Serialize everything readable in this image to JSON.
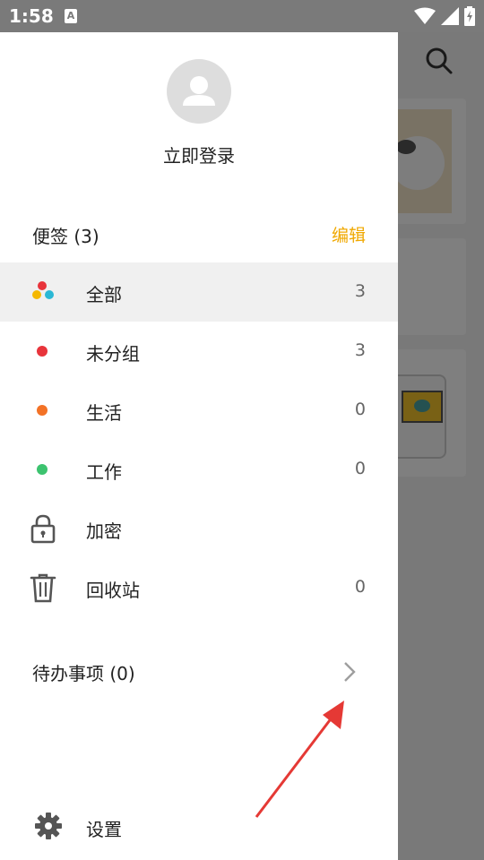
{
  "status_bar": {
    "time": "1:58",
    "notification_icon": "A",
    "icons": [
      "wifi-icon",
      "signal-icon",
      "battery-icon"
    ]
  },
  "drawer": {
    "login_text": "立即登录",
    "notes_section": {
      "title": "便签 (3)",
      "edit_label": "编辑"
    },
    "groups": [
      {
        "label": "全部",
        "count": "3",
        "icon": "multi-color-dots-icon",
        "active": true
      },
      {
        "label": "未分组",
        "count": "3",
        "icon": "dot-icon",
        "color": "#e8343b"
      },
      {
        "label": "生活",
        "count": "0",
        "icon": "dot-icon",
        "color": "#f37226"
      },
      {
        "label": "工作",
        "count": "0",
        "icon": "dot-icon",
        "color": "#3cc36f"
      },
      {
        "label": "加密",
        "count": "",
        "icon": "lock-icon"
      },
      {
        "label": "回收站",
        "count": "0",
        "icon": "trash-icon"
      }
    ],
    "todo": {
      "label": "待办事项 (0)"
    },
    "settings": {
      "label": "设置"
    }
  },
  "colors": {
    "accent": "#f0a800",
    "active_row_bg": "#f0f0f0",
    "annotation_arrow": "#e53935"
  }
}
